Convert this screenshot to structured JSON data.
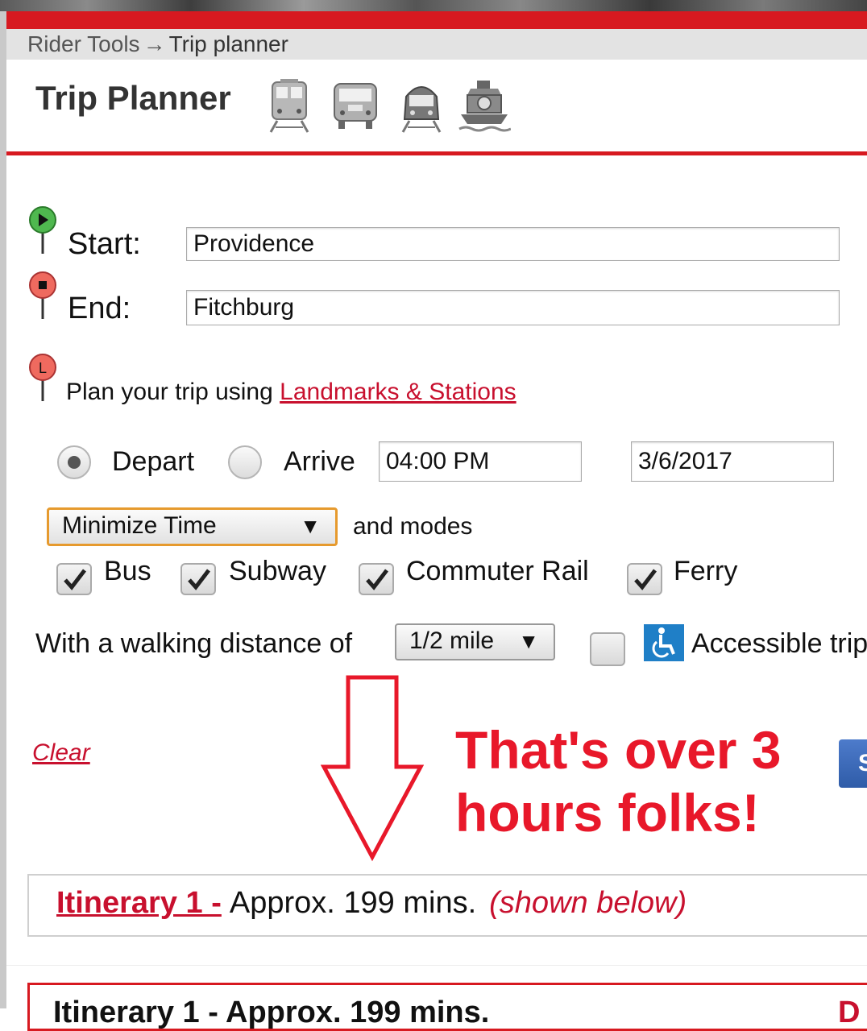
{
  "breadcrumb": {
    "parent": "Rider Tools",
    "arrow": "→",
    "current": "Trip planner"
  },
  "header": {
    "title": "Trip Planner",
    "mode_icons": [
      "subway-icon",
      "bus-icon",
      "commuter-rail-icon",
      "ferry-icon"
    ]
  },
  "form": {
    "start_label": "Start:",
    "start_value": "Providence",
    "end_label": "End:",
    "end_value": "Fitchburg",
    "plan_text": "Plan your trip using ",
    "landmarks_link": "Landmarks & Stations",
    "depart_label": "Depart",
    "arrive_label": "Arrive",
    "depart_selected": true,
    "time_value": "04:00 PM",
    "date_value": "3/6/2017",
    "optimize_value": "Minimize Time",
    "and_modes": "and modes",
    "modes": [
      {
        "label": "Bus",
        "checked": true
      },
      {
        "label": "Subway",
        "checked": true
      },
      {
        "label": "Commuter Rail",
        "checked": true
      },
      {
        "label": "Ferry",
        "checked": true
      }
    ],
    "walk_label": "With a walking distance of",
    "walk_value": "1/2 mile",
    "accessible_label": "Accessible trip",
    "accessible_checked": false,
    "clear_link": "Clear",
    "submit_partial": "S"
  },
  "annotation": {
    "line1": "That's over 3",
    "line2": "hours folks!"
  },
  "itinerary": {
    "link": "Itinerary 1 -",
    "approx": "Approx. 199 mins.",
    "shown": "(shown below)",
    "detail_header": "Itinerary 1 - Approx. 199 mins.",
    "detail_right": "D"
  },
  "colors": {
    "brand_red": "#d71920",
    "link_red": "#c8102e",
    "annotation_red": "#e8182a",
    "select_border": "#e69a2e",
    "accessible_blue": "#1f7fc7"
  }
}
